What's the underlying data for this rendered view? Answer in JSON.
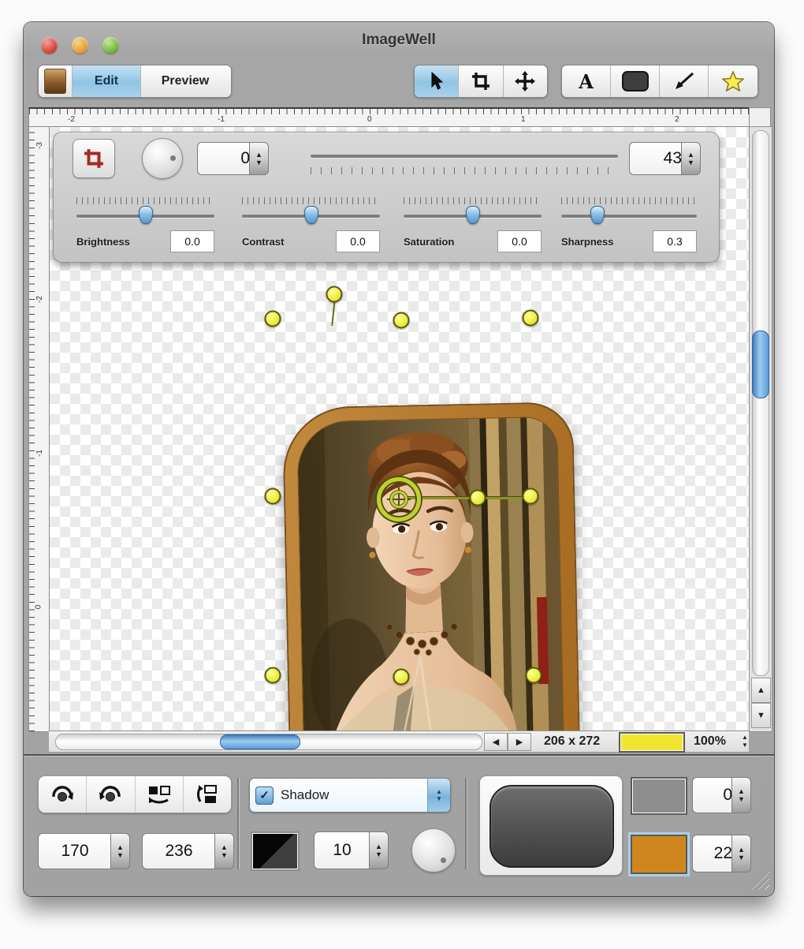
{
  "window": {
    "title": "ImageWell"
  },
  "glyphs": {
    "up": "▲",
    "down": "▼",
    "left": "◀",
    "right": "▶",
    "check": "✓"
  },
  "tabs": {
    "edit": "Edit",
    "preview": "Preview"
  },
  "ruler": {
    "h_labels": [
      "-2",
      "-1",
      "0",
      "1",
      "2"
    ],
    "v_labels": [
      "-3",
      "-2",
      "-1",
      "0"
    ]
  },
  "adjust": {
    "angle_value": "0",
    "size_value": "43",
    "sliders": [
      {
        "label": "Brightness",
        "value": "0.0"
      },
      {
        "label": "Contrast",
        "value": "0.0"
      },
      {
        "label": "Saturation",
        "value": "0.0"
      },
      {
        "label": "Sharpness",
        "value": "0.3"
      }
    ]
  },
  "status": {
    "dimensions": "206 x 272",
    "zoom": "100%",
    "color_hex": "#f2e431"
  },
  "bottom": {
    "x_value": "170",
    "y_value": "236",
    "shadow_label": "Shadow",
    "shadow_blur": "10",
    "opacity_value": "0",
    "border_value": "22",
    "gray_swatch": "#8e8e8e",
    "orange_swatch": "#d0861f"
  },
  "colors": {
    "accent_blue": "#7fb8e0",
    "frame_brown": "#b5782f",
    "handle_yellow": "#ecec3a"
  }
}
